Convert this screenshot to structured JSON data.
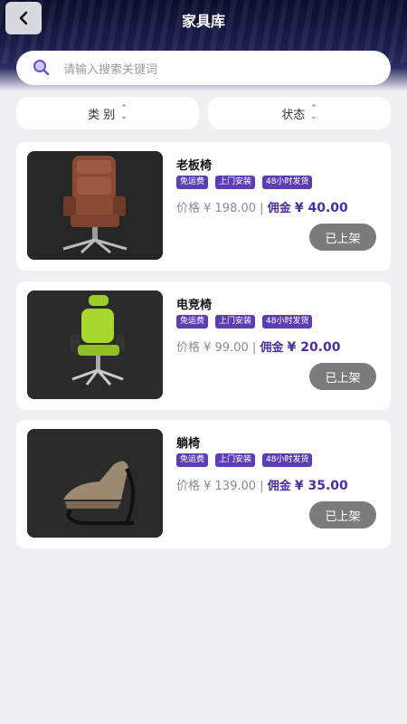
{
  "header": {
    "title": "家具库",
    "back_icon": "chevron-left-icon"
  },
  "search": {
    "placeholder": "请输入搜索关键词",
    "icon": "search-icon"
  },
  "filters": [
    {
      "label": "类 别",
      "icon": "sort-arrows-icon"
    },
    {
      "label": "状态",
      "icon": "sort-arrows-icon"
    }
  ],
  "colors": {
    "tag_bg": "#5b3fb2",
    "commission": "#4a2fa0",
    "status_btn": "#7b7b7b"
  },
  "products": [
    {
      "name": "老板椅",
      "tags": [
        "免运费",
        "上门安装",
        "48小时发货"
      ],
      "price_label": "价格 ¥ 198.00",
      "separator": "|",
      "commission_label": "佣金",
      "commission_value": "¥ 40.00",
      "status": "已上架"
    },
    {
      "name": "电竞椅",
      "tags": [
        "免运费",
        "上门安装",
        "48小时发货"
      ],
      "price_label": "价格 ¥ 99.00",
      "separator": "|",
      "commission_label": "佣金",
      "commission_value": "¥ 20.00",
      "status": "已上架"
    },
    {
      "name": "躺椅",
      "tags": [
        "免运费",
        "上门安装",
        "48小时发货"
      ],
      "price_label": "价格 ¥ 139.00",
      "separator": "|",
      "commission_label": "佣金",
      "commission_value": "¥ 35.00",
      "status": "已上架"
    }
  ]
}
